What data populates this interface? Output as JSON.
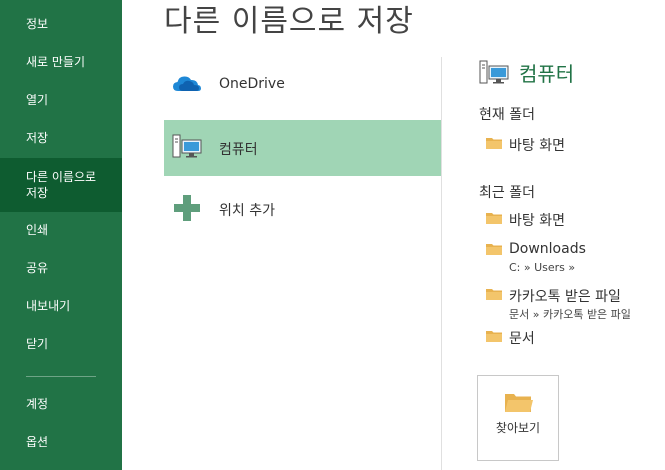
{
  "nav": {
    "items": [
      {
        "label": "정보"
      },
      {
        "label": "새로 만들기"
      },
      {
        "label": "열기"
      },
      {
        "label": "저장"
      },
      {
        "label": "다른 이름으로 저장"
      },
      {
        "label": "인쇄"
      },
      {
        "label": "공유"
      },
      {
        "label": "내보내기"
      },
      {
        "label": "닫기"
      },
      {
        "label": "계정"
      },
      {
        "label": "옵션"
      }
    ],
    "active_item": "다른 이름으로 저장"
  },
  "title": "다른 이름으로 저장",
  "locations": [
    {
      "label": "OneDrive",
      "icon": "onedrive-cloud-icon"
    },
    {
      "label": "컴퓨터",
      "icon": "computer-icon",
      "selected": true
    },
    {
      "label": "위치 추가",
      "icon": "plus-icon"
    }
  ],
  "right_panel": {
    "heading": "컴퓨터",
    "current_folder_title": "현재 폴더",
    "current_folders": [
      {
        "name": "바탕 화면"
      }
    ],
    "recent_folder_title": "최근 폴더",
    "recent_folders": [
      {
        "name": "바탕 화면",
        "path": ""
      },
      {
        "name": "Downloads",
        "path": "C: » Users »"
      },
      {
        "name": "카카오톡 받은 파일",
        "path": "문서 » 카카오톡 받은 파일"
      },
      {
        "name": "문서",
        "path": ""
      }
    ],
    "browse_label": "찾아보기"
  },
  "colors": {
    "nav_bg": "#217346",
    "nav_active": "#0e5c30",
    "selected_location": "#a0d5b5",
    "accent_green": "#217346",
    "folder_yellow": "#f3c56b"
  }
}
